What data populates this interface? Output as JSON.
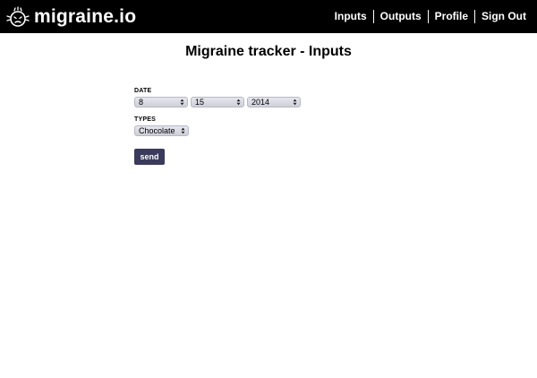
{
  "navbar": {
    "brand": "migraine.io",
    "links": [
      "Inputs",
      "Outputs",
      "Profile",
      "Sign Out"
    ]
  },
  "page": {
    "title": "Migraine tracker - Inputs"
  },
  "form": {
    "date_label": "DATE",
    "month": "8",
    "day": "15",
    "year": "2014",
    "types_label": "TYPES",
    "type": "Chocolate",
    "send_label": "send"
  },
  "colors": {
    "navbar_bg": "#000000",
    "button_bg": "#3a3a5c",
    "select_bg": "#d9d9e2"
  }
}
